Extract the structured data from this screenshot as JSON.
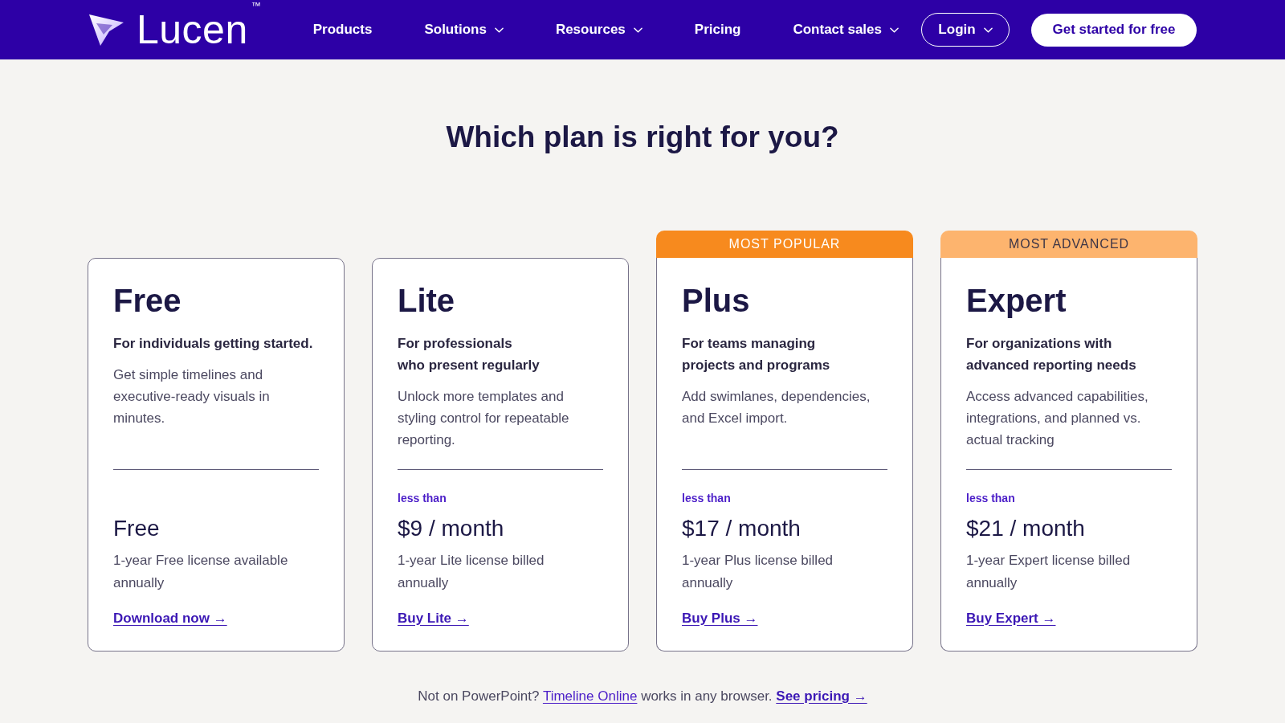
{
  "nav": {
    "logo": {
      "name": "Lucen",
      "trademark": "™"
    },
    "items": [
      {
        "label": "Products",
        "dropdown": false
      },
      {
        "label": "Solutions",
        "dropdown": true
      },
      {
        "label": "Resources",
        "dropdown": true
      },
      {
        "label": "Pricing",
        "dropdown": false
      },
      {
        "label": "Contact sales",
        "dropdown": true
      }
    ],
    "login": {
      "label": "Login",
      "dropdown": true
    },
    "cta": {
      "label": "Get started for free"
    }
  },
  "heading": "Which plan is right for you?",
  "plans": [
    {
      "name": "Free",
      "subtitle_lines": [
        "For individuals getting started."
      ],
      "description_lines": [
        "Get simple timelines and",
        "executive-ready visuals in",
        "minutes."
      ],
      "price": "Free",
      "license_lines": [
        "1-year Free license available",
        "annually"
      ],
      "link": "Download now →"
    },
    {
      "name": "Lite",
      "subtitle_lines": [
        "For professionals",
        "who present regularly"
      ],
      "description_lines": [
        "Unlock more templates and",
        "styling control for repeatable",
        "reporting."
      ],
      "price_prefix": "less than",
      "price": "$9 / month",
      "license_lines": [
        "1-year Lite license billed",
        "annually"
      ],
      "link": "Buy Lite →"
    },
    {
      "name": "Plus",
      "badge": {
        "text": "MOST POPULAR",
        "kind": "strong"
      },
      "subtitle_lines": [
        "For teams managing",
        "projects and programs"
      ],
      "description_lines": [
        "Add swimlanes, dependencies,",
        "and Excel import."
      ],
      "price_prefix": "less than",
      "price": "$17 / month",
      "license_lines": [
        "1-year Plus license billed",
        "annually"
      ],
      "link": "Buy Plus →"
    },
    {
      "name": "Expert",
      "badge": {
        "text": "MOST ADVANCED",
        "kind": "soft"
      },
      "subtitle_lines": [
        "For organizations with",
        "advanced reporting needs"
      ],
      "description_lines": [
        "Access advanced capabilities,",
        "integrations, and planned vs.",
        "actual tracking"
      ],
      "price_prefix": "less than",
      "price": "$21 / month",
      "license_lines": [
        "1-year Expert license billed",
        "annually"
      ],
      "link": "Buy Expert →"
    }
  ],
  "footer": [
    {
      "kind": "text",
      "text": "Not on PowerPoint? "
    },
    {
      "kind": "link",
      "text": "Timeline Online"
    },
    {
      "kind": "text",
      "text": " works in any browser. "
    },
    {
      "kind": "bold_link",
      "text": "See pricing →"
    }
  ]
}
